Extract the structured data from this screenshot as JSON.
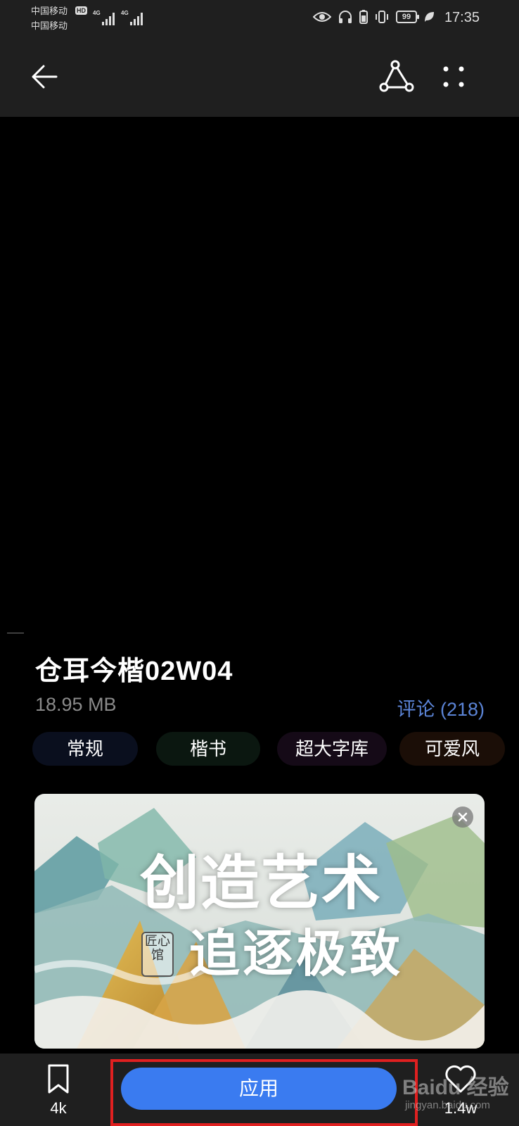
{
  "status_bar": {
    "carrier1": "中国移动",
    "carrier2": "中国移动",
    "hd": "HD",
    "network1": "4G",
    "network2": "4G",
    "battery": "99",
    "time": "17:35"
  },
  "header": {
    "back_icon": "arrow-left-icon",
    "share_icon": "share-icon",
    "more_icon": "more-dots-icon"
  },
  "font": {
    "name": "仓耳今楷02W04",
    "size": "18.95 MB",
    "comments_label": "评论 (218)"
  },
  "tags": [
    "常规",
    "楷书",
    "超大字库",
    "可爱风"
  ],
  "banner": {
    "headline": "创造艺术",
    "subline": "追逐极致",
    "seal_text": "匠心馆"
  },
  "bottom_bar": {
    "bookmark_count": "4k",
    "apply_label": "应用",
    "like_count": "1.4w"
  },
  "watermark": {
    "logo_text": "Bai⁠du 经验",
    "url": "jingyan.baidu.com"
  },
  "colors": {
    "accent": "#3a7bf0",
    "comments": "#5b84d6",
    "highlight": "#e02020"
  }
}
